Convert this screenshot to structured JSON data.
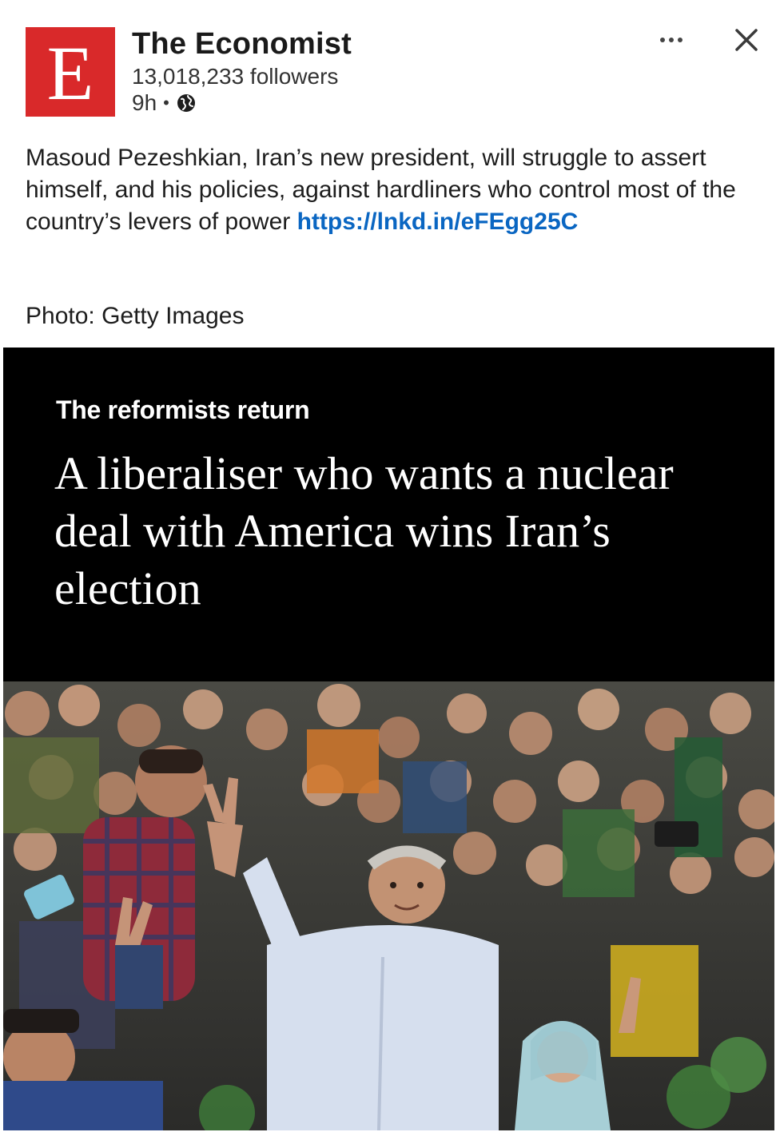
{
  "author": {
    "logo_letter": "E",
    "name": "The Economist",
    "followers": "13,018,233 followers",
    "time": "9h",
    "separator": "•",
    "visibility_icon": "globe-icon"
  },
  "actions": {
    "more_icon": "more-icon",
    "close_icon": "close-icon"
  },
  "post": {
    "text": "Masoud Pezeshkian, Iran’s new president, will struggle to assert himself, and his policies, against hardliners who control most of the country’s levers of power ",
    "link": "https://lnkd.in/eFEgg25C",
    "photo_credit": "Photo: Getty Images"
  },
  "card": {
    "kicker": "The reformists return",
    "headline": "A liberaliser who wants a nuclear deal with America wins Iran’s election"
  },
  "colors": {
    "brand_red": "#d9292a",
    "link_blue": "#0a66c2",
    "card_bg": "#000000"
  }
}
